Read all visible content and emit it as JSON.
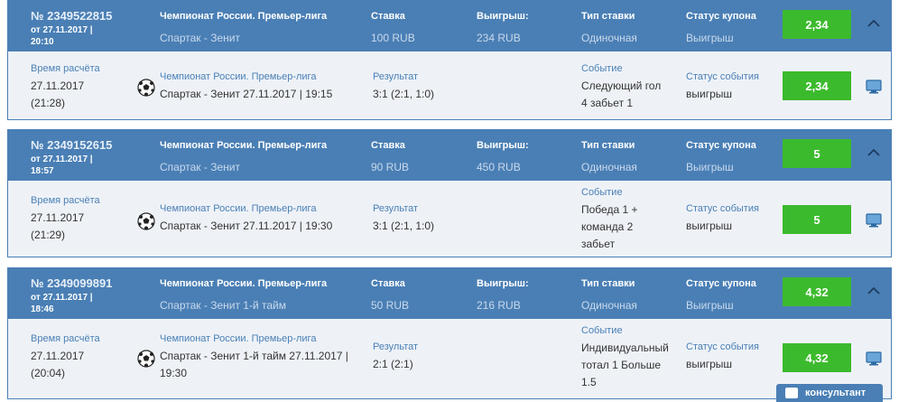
{
  "labels": {
    "tournament": "Чемпионат России. Премьер-лига",
    "stake": "Ставка",
    "winnings": "Выигрыш:",
    "bet_type": "Тип ставки",
    "coupon_status": "Статус купона",
    "calc_time": "Время расчёта",
    "result": "Результат",
    "event": "Событие",
    "event_status": "Статус события"
  },
  "coupons": [
    {
      "number": "№ 2349522815",
      "date_line1": "от 27.11.2017 |",
      "date_line2": "20:10",
      "match": "Спартак - Зенит",
      "stake": "100 RUB",
      "winnings": "234 RUB",
      "bet_type": "Одиночная",
      "status": "Выигрыш",
      "odds": "2,34",
      "detail": {
        "calc_date": "27.11.2017",
        "calc_time": "(21:28)",
        "tournament": "Чемпионат России. Премьер-лига",
        "match_line1": "Спартак - Зенит 27.11.2017 | 19:15",
        "match_line2": "",
        "result": "3:1 (2:1, 1:0)",
        "event_line1": "Следующий гол",
        "event_line2": "4 забьет 1",
        "event_line3": "",
        "event_status": "выигрыш",
        "odds": "2,34"
      }
    },
    {
      "number": "№ 2349152615",
      "date_line1": "от 27.11.2017 |",
      "date_line2": "18:57",
      "match": "Спартак - Зенит",
      "stake": "90 RUB",
      "winnings": "450 RUB",
      "bet_type": "Одиночная",
      "status": "Выигрыш",
      "odds": "5",
      "detail": {
        "calc_date": "27.11.2017",
        "calc_time": "(21:29)",
        "tournament": "Чемпионат России. Премьер-лига",
        "match_line1": "Спартак - Зенит 27.11.2017 | 19:30",
        "match_line2": "",
        "result": "3:1 (2:1, 1:0)",
        "event_line1": "Победа 1 +",
        "event_line2": "команда 2",
        "event_line3": "забьет",
        "event_status": "выигрыш",
        "odds": "5"
      }
    },
    {
      "number": "№ 2349099891",
      "date_line1": "от 27.11.2017 |",
      "date_line2": "18:46",
      "match": "Спартак - Зенит 1-й тайм",
      "stake": "50 RUB",
      "winnings": "216 RUB",
      "bet_type": "Одиночная",
      "status": "Выигрыш",
      "odds": "4,32",
      "detail": {
        "calc_date": "27.11.2017",
        "calc_time": "(20:04)",
        "tournament": "Чемпионат России. Премьер-лига",
        "match_line1": "Спартак - Зенит 1-й тайм 27.11.2017 |",
        "match_line2": "19:30",
        "result": "2:1 (2:1)",
        "event_line1": "Индивидуальный",
        "event_line2": "тотал 1 Больше",
        "event_line3": "1.5",
        "event_status": "выигрыш",
        "odds": "4,32"
      }
    }
  ],
  "consultant": "консультант",
  "colors": {
    "header": "#4a7fb5",
    "badge": "#3cba2d",
    "body": "#eef2f7"
  },
  "icons": [
    "soccer-ball-icon",
    "chevron-up-icon",
    "monitor-icon"
  ]
}
